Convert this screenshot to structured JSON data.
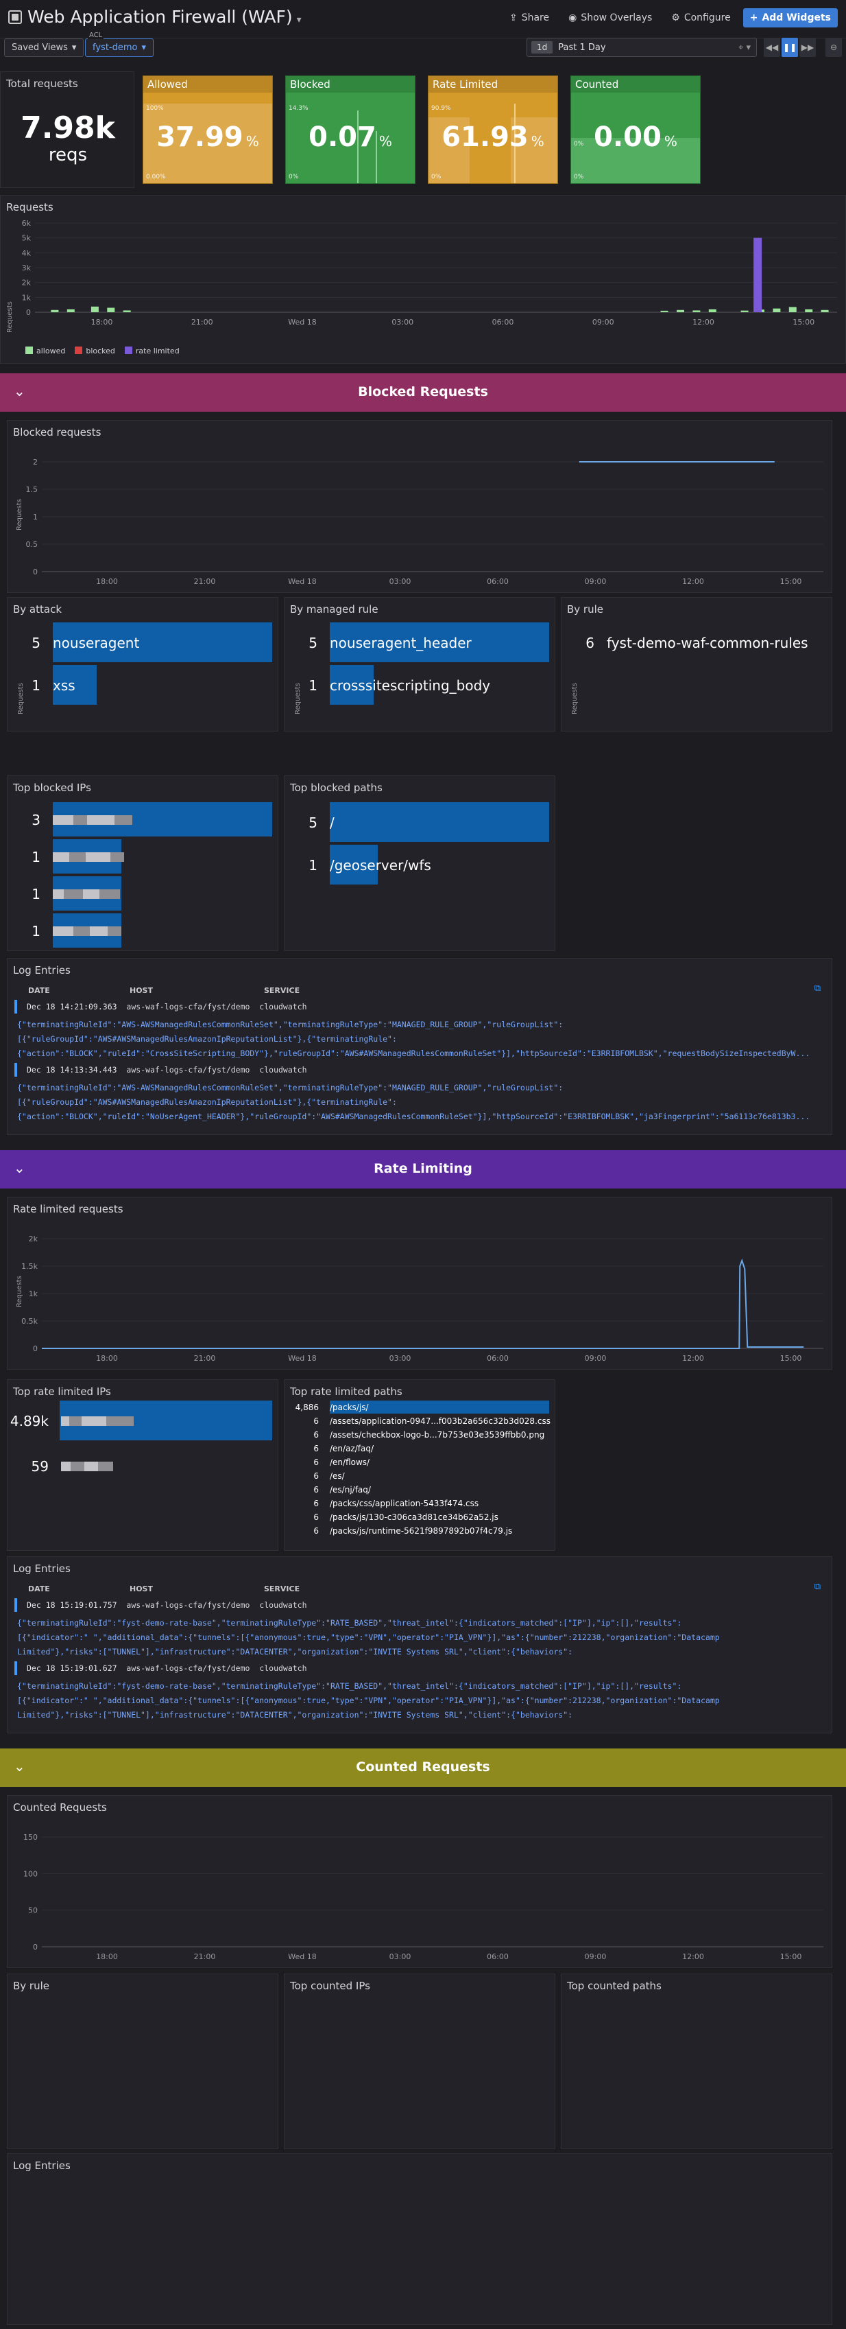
{
  "header": {
    "title": "Web Application Firewall (WAF)",
    "share": "Share",
    "overlays": "Show Overlays",
    "configure": "Configure",
    "add_widgets": "Add Widgets"
  },
  "filters": {
    "saved_views": "Saved Views",
    "acl_label": "ACL",
    "acl_value": "fyst-demo",
    "time_badge": "1d",
    "time_value": "Past 1 Day"
  },
  "stats": {
    "total_label": "Total requests",
    "total_value": "7.98k",
    "total_unit": "reqs",
    "tiles": [
      {
        "name": "Allowed",
        "value": "37.99",
        "unit": "%",
        "max": "100%",
        "min": "0.00%",
        "color": "#d49a2a"
      },
      {
        "name": "Blocked",
        "value": "0.07",
        "unit": "%",
        "max": "14.3%",
        "min": "0%",
        "color": "#3a9a48"
      },
      {
        "name": "Rate Limited",
        "value": "61.93",
        "unit": "%",
        "max": "90.9%",
        "min": "0%",
        "color": "#d49a2a"
      },
      {
        "name": "Counted",
        "value": "0.00",
        "unit": "%",
        "max": "",
        "min": "0%",
        "mid": "0%",
        "color": "#3a9a48"
      }
    ]
  },
  "requests_chart": {
    "title": "Requests",
    "ylabel": "Requests",
    "legend": [
      {
        "name": "allowed",
        "color": "#9be29b"
      },
      {
        "name": "blocked",
        "color": "#d94040"
      },
      {
        "name": "rate limited",
        "color": "#7a5ad8"
      }
    ]
  },
  "sections": {
    "blocked": "Blocked Requests",
    "rate": "Rate Limiting",
    "counted": "Counted Requests"
  },
  "blocked_chart": {
    "title": "Blocked requests",
    "ylabel": "Requests"
  },
  "by_attack": {
    "title": "By attack",
    "ylabel": "Requests",
    "rows": [
      {
        "n": "5",
        "label": "nouseragent"
      },
      {
        "n": "1",
        "label": "xss"
      }
    ]
  },
  "by_managed_rule": {
    "title": "By managed rule",
    "ylabel": "Requests",
    "rows": [
      {
        "n": "5",
        "label": "nouseragent_header"
      },
      {
        "n": "1",
        "label": "crosssitescripting_body"
      }
    ]
  },
  "by_rule": {
    "title": "By rule",
    "ylabel": "Requests",
    "rows": [
      {
        "n": "6",
        "label": "fyst-demo-waf-common-rules"
      }
    ]
  },
  "top_blocked_ips": {
    "title": "Top blocked IPs",
    "rows": [
      {
        "n": "3"
      },
      {
        "n": "1"
      },
      {
        "n": "1"
      },
      {
        "n": "1"
      }
    ]
  },
  "top_blocked_paths": {
    "title": "Top blocked paths",
    "rows": [
      {
        "n": "5",
        "label": "/"
      },
      {
        "n": "1",
        "label": "/geoserver/wfs"
      }
    ]
  },
  "log1": {
    "title": "Log Entries",
    "col_date": "DATE",
    "col_host": "HOST",
    "col_service": "SERVICE",
    "entries": [
      {
        "date": "Dec 18 14:21:09.363",
        "host": "aws-waf-logs-cfa/fyst/demo",
        "service": "cloudwatch",
        "l1": "{\"terminatingRuleId\":\"AWS-AWSManagedRulesCommonRuleSet\",\"terminatingRuleType\":\"MANAGED_RULE_GROUP\",\"ruleGroupList\":",
        "l2": "[{\"ruleGroupId\":\"AWS#AWSManagedRulesAmazonIpReputationList\"},{\"terminatingRule\":",
        "l3": "{\"action\":\"BLOCK\",\"ruleId\":\"CrossSiteScripting_BODY\"},\"ruleGroupId\":\"AWS#AWSManagedRulesCommonRuleSet\"}],\"httpSourceId\":\"E3RRIBFOMLBSK\",\"requestBodySizeInspectedByW..."
      },
      {
        "date": "Dec 18 14:13:34.443",
        "host": "aws-waf-logs-cfa/fyst/demo",
        "service": "cloudwatch",
        "l1": "{\"terminatingRuleId\":\"AWS-AWSManagedRulesCommonRuleSet\",\"terminatingRuleType\":\"MANAGED_RULE_GROUP\",\"ruleGroupList\":",
        "l2": "[{\"ruleGroupId\":\"AWS#AWSManagedRulesAmazonIpReputationList\"},{\"terminatingRule\":",
        "l3": "{\"action\":\"BLOCK\",\"ruleId\":\"NoUserAgent_HEADER\"},\"ruleGroupId\":\"AWS#AWSManagedRulesCommonRuleSet\"}],\"httpSourceId\":\"E3RRIBFOMLBSK\",\"ja3Fingerprint\":\"5a6113c76e813b3..."
      }
    ]
  },
  "rate_chart": {
    "title": "Rate limited requests",
    "ylabel": "Requests"
  },
  "top_rate_ips": {
    "title": "Top rate limited IPs",
    "rows": [
      {
        "n": "4.89k"
      },
      {
        "n": "59"
      }
    ]
  },
  "top_rate_paths": {
    "title": "Top rate limited paths",
    "rows": [
      {
        "n": "4,886",
        "label": "/packs/js/"
      },
      {
        "n": "6",
        "label": "/assets/application-0947...f003b2a656c32b3d028.css"
      },
      {
        "n": "6",
        "label": "/assets/checkbox-logo-b...7b753e03e3539ffbb0.png"
      },
      {
        "n": "6",
        "label": "/en/az/faq/"
      },
      {
        "n": "6",
        "label": "/en/flows/"
      },
      {
        "n": "6",
        "label": "/es/"
      },
      {
        "n": "6",
        "label": "/es/nj/faq/"
      },
      {
        "n": "6",
        "label": "/packs/css/application-5433f474.css"
      },
      {
        "n": "6",
        "label": "/packs/js/130-c306ca3d81ce34b62a52.js"
      },
      {
        "n": "6",
        "label": "/packs/js/runtime-5621f9897892b07f4c79.js"
      }
    ]
  },
  "log2": {
    "title": "Log Entries",
    "col_date": "DATE",
    "col_host": "HOST",
    "col_service": "SERVICE",
    "entries": [
      {
        "date": "Dec 18 15:19:01.757",
        "host": "aws-waf-logs-cfa/fyst/demo",
        "service": "cloudwatch",
        "l1": "{\"terminatingRuleId\":\"fyst-demo-rate-base\",\"terminatingRuleType\":\"RATE_BASED\",\"threat_intel\":{\"indicators_matched\":[\"IP\"],\"ip\":[],\"results\":",
        "l2": "[{\"indicator\":\"           \",\"additional_data\":{\"tunnels\":[{\"anonymous\":true,\"type\":\"VPN\",\"operator\":\"PIA_VPN\"}],\"as\":{\"number\":212238,\"organization\":\"Datacamp",
        "l3": "Limited\"},\"risks\":[\"TUNNEL\"],\"infrastructure\":\"DATACENTER\",\"organization\":\"INVITE Systems SRL\",\"client\":{\"behaviors\":"
      },
      {
        "date": "Dec 18 15:19:01.627",
        "host": "aws-waf-logs-cfa/fyst/demo",
        "service": "cloudwatch",
        "l1": "{\"terminatingRuleId\":\"fyst-demo-rate-base\",\"terminatingRuleType\":\"RATE_BASED\",\"threat_intel\":{\"indicators_matched\":[\"IP\"],\"ip\":[],\"results\":",
        "l2": "[{\"indicator\":\"           \",\"additional_data\":{\"tunnels\":[{\"anonymous\":true,\"type\":\"VPN\",\"operator\":\"PIA_VPN\"}],\"as\":{\"number\":212238,\"organization\":\"Datacamp",
        "l3": "Limited\"},\"risks\":[\"TUNNEL\"],\"infrastructure\":\"DATACENTER\",\"organization\":\"INVITE Systems SRL\",\"client\":{\"behaviors\":"
      }
    ]
  },
  "counted_chart": {
    "title": "Counted Requests"
  },
  "counted_by_rule": {
    "title": "By rule"
  },
  "counted_ips": {
    "title": "Top counted IPs"
  },
  "counted_paths": {
    "title": "Top counted paths"
  },
  "log3": {
    "title": "Log Entries"
  },
  "chart_data": [
    {
      "type": "bar",
      "title": "Requests",
      "ylabel": "Requests",
      "x_ticks": [
        "18:00",
        "21:00",
        "Wed 18",
        "03:00",
        "06:00",
        "09:00",
        "12:00",
        "15:00"
      ],
      "y_ticks": [
        "0",
        "1k",
        "2k",
        "3k",
        "4k",
        "5k",
        "6k"
      ],
      "ylim": [
        0,
        6000
      ],
      "series": [
        {
          "name": "allowed",
          "note": "small bars ~100-400 around 16:00-18:00 and 10:00-15:30"
        },
        {
          "name": "rate limited",
          "peak": 5000,
          "peak_x": "13:30"
        }
      ]
    },
    {
      "type": "line",
      "title": "Blocked requests",
      "ylabel": "Requests",
      "x_ticks": [
        "18:00",
        "21:00",
        "Wed 18",
        "03:00",
        "06:00",
        "09:00",
        "12:00",
        "15:00"
      ],
      "y_ticks": [
        "0",
        "0.5",
        "1",
        "1.5",
        "2"
      ],
      "ylim": [
        0,
        2
      ],
      "series": [
        {
          "name": "blocked",
          "values": [
            [
              "08:30",
              2
            ],
            [
              "14:30",
              2
            ]
          ]
        }
      ]
    },
    {
      "type": "line",
      "title": "Rate limited requests",
      "ylabel": "Requests",
      "x_ticks": [
        "18:00",
        "21:00",
        "Wed 18",
        "03:00",
        "06:00",
        "09:00",
        "12:00",
        "15:00"
      ],
      "y_ticks": [
        "0",
        "0.5k",
        "1k",
        "1.5k",
        "2k"
      ],
      "ylim": [
        0,
        2000
      ],
      "series": [
        {
          "name": "rate limited",
          "peak": 1600,
          "peak_x": "13:30"
        }
      ]
    },
    {
      "type": "line",
      "title": "Counted Requests",
      "x_ticks": [
        "18:00",
        "21:00",
        "Wed 18",
        "03:00",
        "06:00",
        "09:00",
        "12:00",
        "15:00"
      ],
      "y_ticks": [
        "0",
        "50",
        "100",
        "150"
      ],
      "ylim": [
        0,
        150
      ],
      "series": []
    }
  ]
}
